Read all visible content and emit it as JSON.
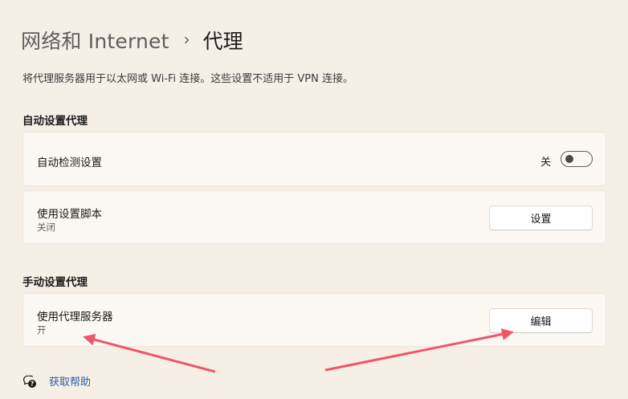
{
  "breadcrumb": {
    "parent": "网络和 Internet",
    "separator": "›",
    "current": "代理"
  },
  "description": "将代理服务器用于以太网或 Wi-Fi 连接。这些设置不适用于 VPN 连接。",
  "auto_proxy": {
    "section_title": "自动设置代理",
    "auto_detect": {
      "label": "自动检测设置",
      "toggle_state": "关",
      "toggle_on": false
    },
    "setup_script": {
      "label": "使用设置脚本",
      "status": "关闭",
      "button_label": "设置"
    }
  },
  "manual_proxy": {
    "section_title": "手动设置代理",
    "use_proxy": {
      "label": "使用代理服务器",
      "status": "开",
      "button_label": "编辑"
    }
  },
  "help": {
    "label": "获取帮助"
  },
  "colors": {
    "background": "#f6efe6",
    "card": "#fbf8f4",
    "link": "#2a5fa6",
    "annotation_arrow": "#f0566a"
  }
}
